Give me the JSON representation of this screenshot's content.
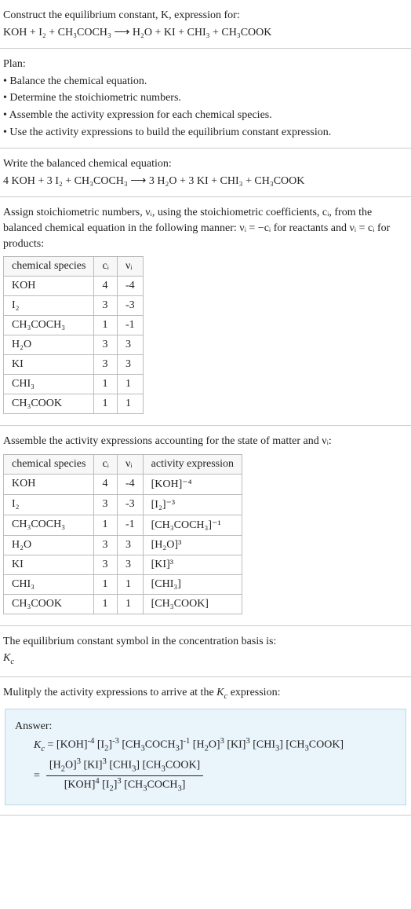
{
  "intro": {
    "line1": "Construct the equilibrium constant, K, expression for:",
    "line2": "KOH + I₂ + CH₃COCH₃ ⟶ H₂O + KI + CHI₃ + CH₃COOK"
  },
  "plan": {
    "title": "Plan:",
    "items": [
      "• Balance the chemical equation.",
      "• Determine the stoichiometric numbers.",
      "• Assemble the activity expression for each chemical species.",
      "• Use the activity expressions to build the equilibrium constant expression."
    ]
  },
  "balanced": {
    "title": "Write the balanced chemical equation:",
    "eqn": "4 KOH + 3 I₂ + CH₃COCH₃ ⟶ 3 H₂O + 3 KI + CHI₃ + CH₃COOK"
  },
  "stoich": {
    "text": "Assign stoichiometric numbers, νᵢ, using the stoichiometric coefficients, cᵢ, from the balanced chemical equation in the following manner: νᵢ = −cᵢ for reactants and νᵢ = cᵢ for products:",
    "headers": [
      "chemical species",
      "cᵢ",
      "νᵢ"
    ],
    "rows": [
      [
        "KOH",
        "4",
        "-4"
      ],
      [
        "I₂",
        "3",
        "-3"
      ],
      [
        "CH₃COCH₃",
        "1",
        "-1"
      ],
      [
        "H₂O",
        "3",
        "3"
      ],
      [
        "KI",
        "3",
        "3"
      ],
      [
        "CHI₃",
        "1",
        "1"
      ],
      [
        "CH₃COOK",
        "1",
        "1"
      ]
    ]
  },
  "activity": {
    "text": "Assemble the activity expressions accounting for the state of matter and νᵢ:",
    "headers": [
      "chemical species",
      "cᵢ",
      "νᵢ",
      "activity expression"
    ],
    "rows": [
      [
        "KOH",
        "4",
        "-4",
        "[KOH]⁻⁴"
      ],
      [
        "I₂",
        "3",
        "-3",
        "[I₂]⁻³"
      ],
      [
        "CH₃COCH₃",
        "1",
        "-1",
        "[CH₃COCH₃]⁻¹"
      ],
      [
        "H₂O",
        "3",
        "3",
        "[H₂O]³"
      ],
      [
        "KI",
        "3",
        "3",
        "[KI]³"
      ],
      [
        "CHI₃",
        "1",
        "1",
        "[CHI₃]"
      ],
      [
        "CH₃COOK",
        "1",
        "1",
        "[CH₃COOK]"
      ]
    ]
  },
  "symbol": {
    "line1": "The equilibrium constant symbol in the concentration basis is:",
    "line2": "K_c"
  },
  "multiply": {
    "text": "Mulitply the activity expressions to arrive at the K_c expression:"
  },
  "answer": {
    "label": "Answer:",
    "kc_eq": "K_c = [KOH]⁻⁴ [I₂]⁻³ [CH₃COCH₃]⁻¹ [H₂O]³ [KI]³ [CHI₃] [CH₃COOK]",
    "frac_num": "[H₂O]³ [KI]³ [CHI₃] [CH₃COOK]",
    "frac_den": "[KOH]⁴ [I₂]³ [CH₃COCH₃]"
  },
  "chart_data": {
    "type": "table",
    "tables": [
      {
        "title": "Stoichiometric numbers",
        "columns": [
          "chemical species",
          "c_i",
          "nu_i"
        ],
        "rows": [
          {
            "chemical species": "KOH",
            "c_i": 4,
            "nu_i": -4
          },
          {
            "chemical species": "I2",
            "c_i": 3,
            "nu_i": -3
          },
          {
            "chemical species": "CH3COCH3",
            "c_i": 1,
            "nu_i": -1
          },
          {
            "chemical species": "H2O",
            "c_i": 3,
            "nu_i": 3
          },
          {
            "chemical species": "KI",
            "c_i": 3,
            "nu_i": 3
          },
          {
            "chemical species": "CHI3",
            "c_i": 1,
            "nu_i": 1
          },
          {
            "chemical species": "CH3COOK",
            "c_i": 1,
            "nu_i": 1
          }
        ]
      },
      {
        "title": "Activity expressions",
        "columns": [
          "chemical species",
          "c_i",
          "nu_i",
          "activity expression"
        ],
        "rows": [
          {
            "chemical species": "KOH",
            "c_i": 4,
            "nu_i": -4,
            "activity expression": "[KOH]^-4"
          },
          {
            "chemical species": "I2",
            "c_i": 3,
            "nu_i": -3,
            "activity expression": "[I2]^-3"
          },
          {
            "chemical species": "CH3COCH3",
            "c_i": 1,
            "nu_i": -1,
            "activity expression": "[CH3COCH3]^-1"
          },
          {
            "chemical species": "H2O",
            "c_i": 3,
            "nu_i": 3,
            "activity expression": "[H2O]^3"
          },
          {
            "chemical species": "KI",
            "c_i": 3,
            "nu_i": 3,
            "activity expression": "[KI]^3"
          },
          {
            "chemical species": "CHI3",
            "c_i": 1,
            "nu_i": 1,
            "activity expression": "[CHI3]"
          },
          {
            "chemical species": "CH3COOK",
            "c_i": 1,
            "nu_i": 1,
            "activity expression": "[CH3COOK]"
          }
        ]
      }
    ]
  }
}
